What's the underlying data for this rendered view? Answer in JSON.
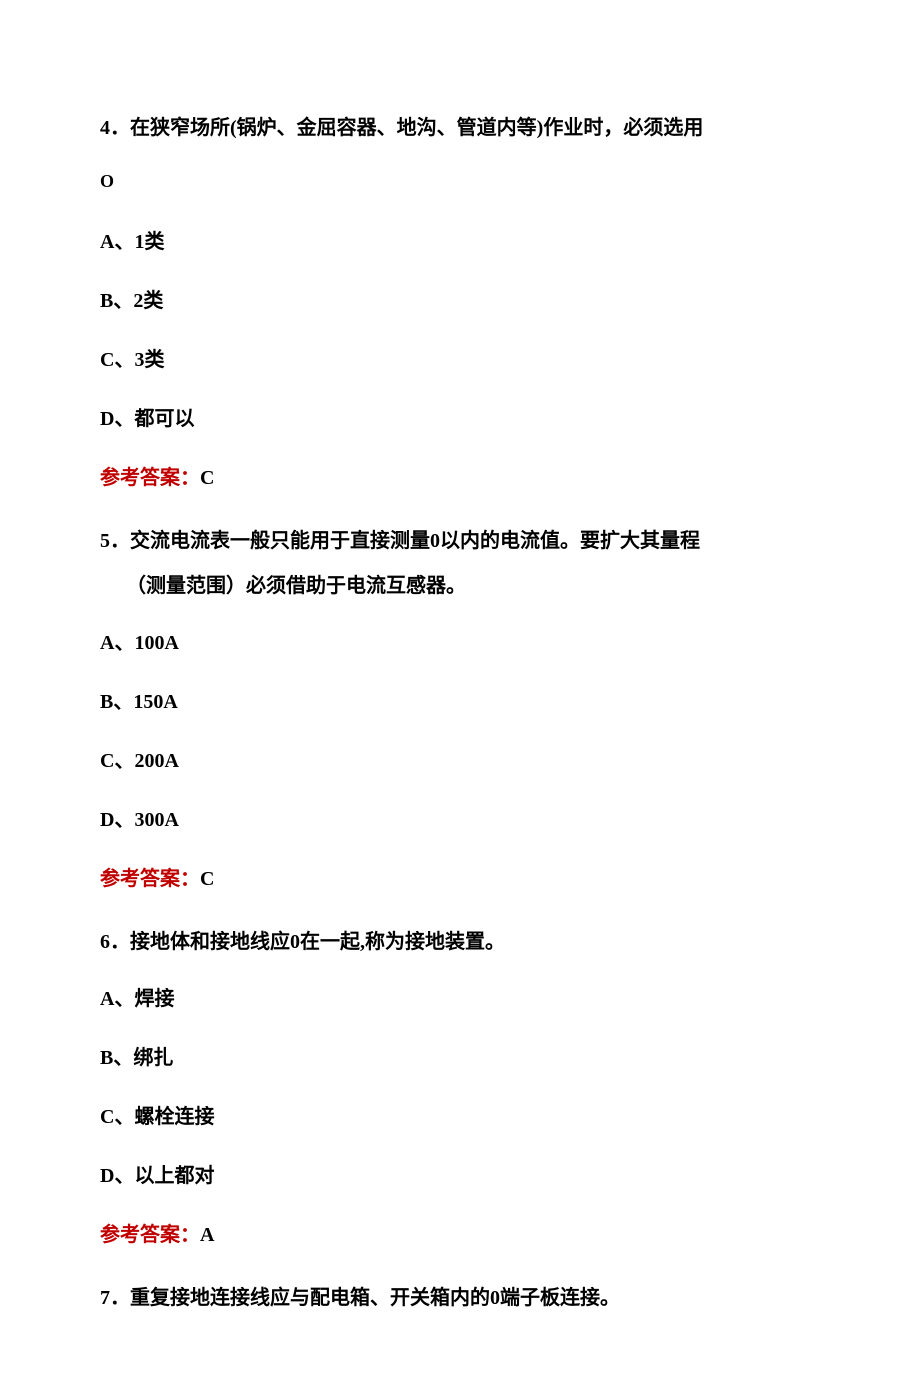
{
  "questions": [
    {
      "number": "4",
      "text_line1": "．在狭窄场所(锅炉、金屈容器、地沟、管道内等)作业时，必须选用",
      "circle": "O",
      "options": {
        "a": "A、1类",
        "b": "B、2类",
        "c": "C、3类",
        "d": "D、都可以"
      },
      "answer_label": "参考答案：",
      "answer_value": "C"
    },
    {
      "number": "5",
      "text_line1": "．交流电流表一般只能用于直接测量0以内的电流值。要扩大其量程",
      "text_line2": "（测量范围）必须借助于电流互感器。",
      "options": {
        "a": "A、100A",
        "b": "B、150A",
        "c": "C、200A",
        "d": "D、300A"
      },
      "answer_label": "参考答案：",
      "answer_value": "C"
    },
    {
      "number": "6",
      "text_line1": "．接地体和接地线应0在一起,称为接地装置。",
      "options": {
        "a": "A、焊接",
        "b": "B、绑扎",
        "c": "C、螺栓连接",
        "d": "D、以上都对"
      },
      "answer_label": "参考答案：",
      "answer_value": "A"
    },
    {
      "number": "7",
      "text_line1": "．重复接地连接线应与配电箱、开关箱内的0端子板连接。"
    }
  ]
}
